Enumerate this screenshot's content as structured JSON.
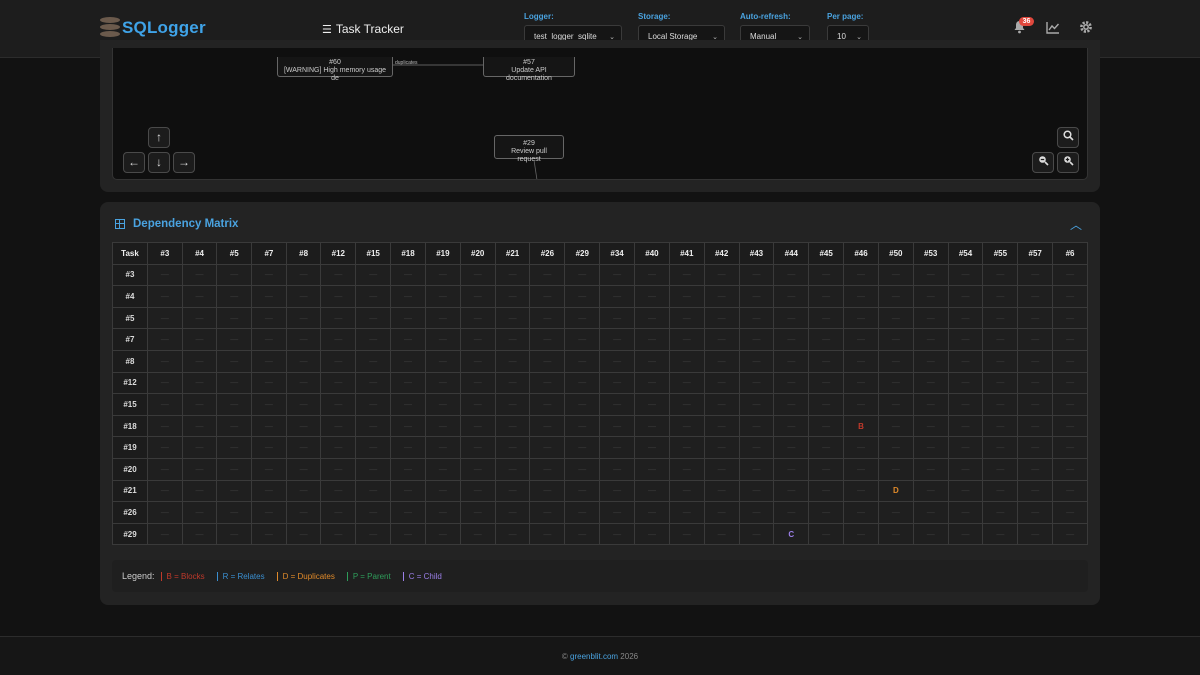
{
  "header": {
    "brand": "SQLogger",
    "page_title": "Task Tracker",
    "notification_count": "36",
    "controls": {
      "logger": {
        "label": "Logger:",
        "value": "test_logger_sqlite"
      },
      "storage": {
        "label": "Storage:",
        "value": "Local Storage"
      },
      "refresh": {
        "label": "Auto-refresh:",
        "value": "Manual"
      },
      "per_page": {
        "label": "Per page:",
        "value": "10"
      }
    },
    "icons": [
      "bell-icon",
      "chart-line-icon",
      "gear-icon"
    ]
  },
  "graph": {
    "nodes": [
      {
        "id": "#60",
        "title": "[WARNING] High memory usage de"
      },
      {
        "id": "#57",
        "title": "Update API documentation"
      },
      {
        "id": "#29",
        "title": "Review pull request"
      }
    ],
    "edge_label": "duplicates"
  },
  "matrix": {
    "title": "Dependency Matrix",
    "corner_label": "Task",
    "columns": [
      "#3",
      "#4",
      "#5",
      "#7",
      "#8",
      "#12",
      "#15",
      "#18",
      "#19",
      "#20",
      "#21",
      "#26",
      "#29",
      "#34",
      "#40",
      "#41",
      "#42",
      "#43",
      "#44",
      "#45",
      "#46",
      "#50",
      "#53",
      "#54",
      "#55",
      "#57",
      "#6"
    ],
    "rows": [
      "#3",
      "#4",
      "#5",
      "#7",
      "#8",
      "#12",
      "#15",
      "#18",
      "#19",
      "#20",
      "#21",
      "#26",
      "#29"
    ],
    "empty_cell": "—",
    "relations": [
      {
        "row": "#18",
        "col": "#46",
        "type": "B"
      },
      {
        "row": "#21",
        "col": "#50",
        "type": "D"
      },
      {
        "row": "#29",
        "col": "#44",
        "type": "C"
      }
    ],
    "legend_label": "Legend:",
    "legend": [
      {
        "key": "B",
        "text": "B = Blocks",
        "color": "#c0392b"
      },
      {
        "key": "R",
        "text": "R = Relates",
        "color": "#3a8fd0"
      },
      {
        "key": "D",
        "text": "D = Duplicates",
        "color": "#e08a2a"
      },
      {
        "key": "P",
        "text": "P = Parent",
        "color": "#2e9d5a"
      },
      {
        "key": "C",
        "text": "C = Child",
        "color": "#9b7fe8"
      }
    ]
  },
  "footer": {
    "prefix": "©",
    "link": "greenblit.com",
    "year": "2026"
  }
}
